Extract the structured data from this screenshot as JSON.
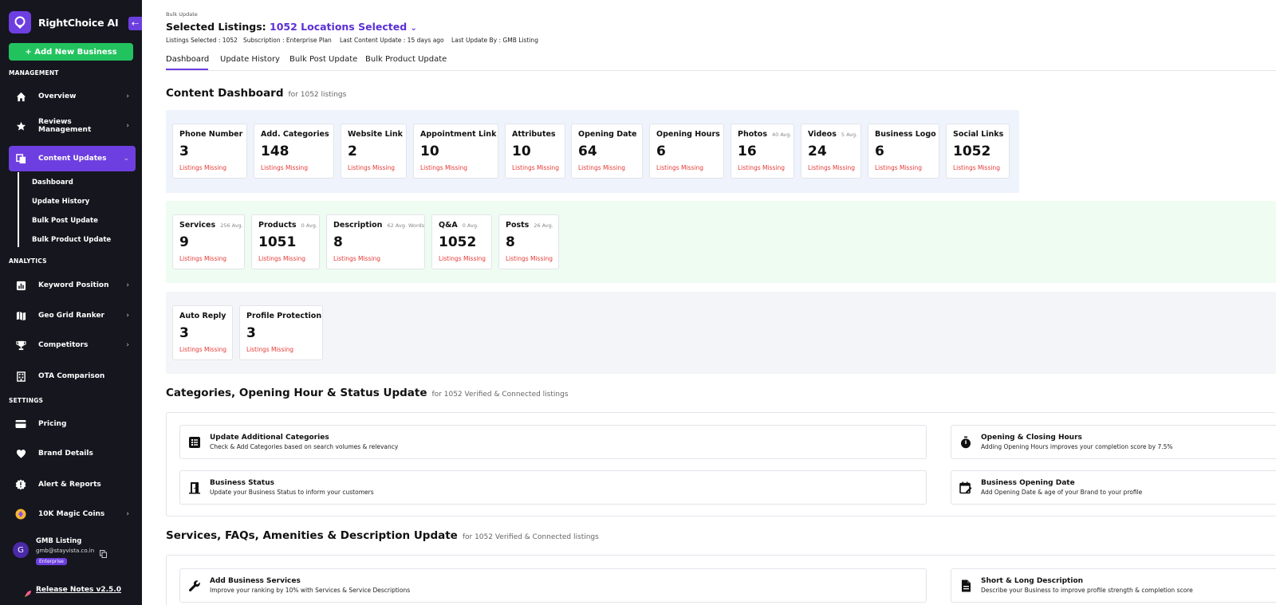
{
  "app": {
    "name": "RightChoice AI",
    "add_business_label": "+ Add New Business"
  },
  "sidebar": {
    "sections": {
      "management": "MANAGEMENT",
      "analytics": "ANALYTICS",
      "settings": "SETTINGS"
    },
    "items": {
      "overview": "Overview",
      "reviews": "Reviews Management",
      "content": "Content Updates",
      "keyword": "Keyword Position",
      "geogrid": "Geo Grid Ranker",
      "competitors": "Competitors",
      "ota": "OTA Comparison",
      "pricing": "Pricing",
      "brand": "Brand Details",
      "alerts": "Alert & Reports",
      "coins": "10K Magic Coins"
    },
    "sub_items": [
      "Dashboard",
      "Update History",
      "Bulk Post Update",
      "Bulk Product Update"
    ],
    "user": {
      "initial": "G",
      "name": "GMB Listing",
      "email": "gmb@stayvista.co.in",
      "plan": "Enterprise"
    },
    "release_notes": "Release Notes v2.5.0"
  },
  "header": {
    "breadcrumb": "Bulk Update",
    "title_prefix": "Selected Listings:",
    "title_value": "1052 Locations Selected",
    "meta": {
      "listings": "Listings Selected : 1052",
      "subscription": "Subscription : Enterprise Plan",
      "last_content": "Last Content Update : 15 days ago",
      "last_by": "Last Update By : GMB Listing"
    },
    "tabs": [
      "Dashboard",
      "Update History",
      "Bulk Post Update",
      "Bulk Product Update"
    ]
  },
  "content_dashboard": {
    "title": "Content Dashboard",
    "subtitle": "for 1052 listings",
    "missing_label": "Listings Missing",
    "row1": [
      {
        "title": "Phone Number",
        "avg": "",
        "value": "3"
      },
      {
        "title": "Add. Categories",
        "avg": "",
        "value": "148"
      },
      {
        "title": "Website Link",
        "avg": "",
        "value": "2"
      },
      {
        "title": "Appointment Link",
        "avg": "",
        "value": "10"
      },
      {
        "title": "Attributes",
        "avg": "",
        "value": "10"
      },
      {
        "title": "Opening Date",
        "avg": "",
        "value": "64"
      },
      {
        "title": "Opening Hours",
        "avg": "",
        "value": "6"
      },
      {
        "title": "Photos",
        "avg": "40 Avg.",
        "value": "16"
      },
      {
        "title": "Videos",
        "avg": "5 Avg.",
        "value": "24"
      },
      {
        "title": "Business Logo",
        "avg": "",
        "value": "6"
      },
      {
        "title": "Social Links",
        "avg": "",
        "value": "1052"
      }
    ],
    "row2": [
      {
        "title": "Services",
        "avg": "256 Avg.",
        "value": "9"
      },
      {
        "title": "Products",
        "avg": "0 Avg.",
        "value": "1051"
      },
      {
        "title": "Description",
        "avg": "62 Avg. Words",
        "value": "8"
      },
      {
        "title": "Q&A",
        "avg": "0 Avg.",
        "value": "1052"
      },
      {
        "title": "Posts",
        "avg": "26 Avg.",
        "value": "8"
      }
    ],
    "row3": [
      {
        "title": "Auto Reply",
        "avg": "",
        "value": "3"
      },
      {
        "title": "Profile Protection",
        "avg": "",
        "value": "3"
      }
    ]
  },
  "categories_section": {
    "title": "Categories, Opening Hour & Status Update",
    "subtitle": "for 1052 Verified & Connected listings",
    "actions": [
      {
        "title": "Update Additional Categories",
        "desc": "Check & Add Categories based on search volumes & relevancy"
      },
      {
        "title": "Opening & Closing Hours",
        "desc": "Adding Opening Hours improves your completion score by 7.5%"
      },
      {
        "title": "Business Status",
        "desc": "Update your Business Status to inform your customers"
      },
      {
        "title": "Business Opening Date",
        "desc": "Add Opening Date & age of your Brand to your profile"
      }
    ]
  },
  "services_section": {
    "title": "Services, FAQs, Amenities & Description Update",
    "subtitle": "for 1052 Verified & Connected listings",
    "actions": [
      {
        "title": "Add Business Services",
        "desc": "Improve your ranking by 10% with Services & Service Descriptions"
      },
      {
        "title": "Short & Long Description",
        "desc": "Describe your Business to improve profile strength & completion score"
      }
    ]
  },
  "colors": {
    "accent": "#6d3fe0",
    "green": "#22c35e",
    "missing": "#e53935",
    "sidebar": "#16161f"
  }
}
